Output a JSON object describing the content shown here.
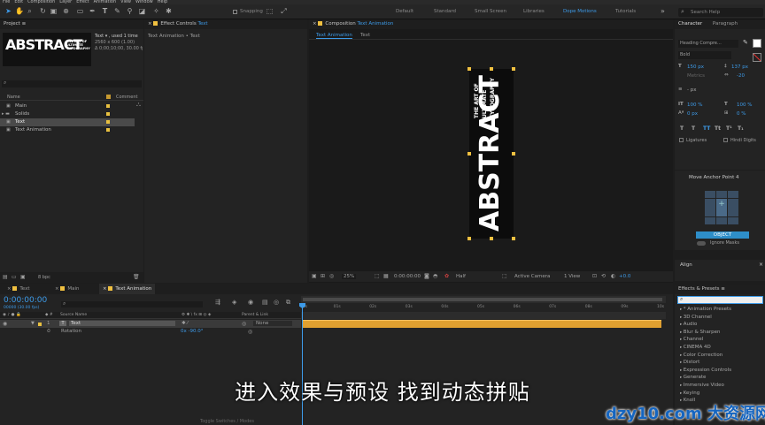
{
  "menu": [
    "File",
    "Edit",
    "Composition",
    "Layer",
    "Effect",
    "Animation",
    "View",
    "Window",
    "Help"
  ],
  "toolbar": {
    "snapping_label": "Snapping"
  },
  "workspaces": [
    {
      "label": "Default",
      "active": false
    },
    {
      "label": "Standard",
      "active": false
    },
    {
      "label": "Small Screen",
      "active": false
    },
    {
      "label": "Libraries",
      "active": false
    },
    {
      "label": "Dope Motions",
      "active": true
    },
    {
      "label": "Tutorials",
      "active": false
    }
  ],
  "help_search": {
    "placeholder": "Search Help"
  },
  "project": {
    "title": "Project",
    "thumb_title": "ABSTRACT",
    "thumb_subtitle": "THE ART OF ULTIMATE TYPOGRAPHY",
    "item_name": "Text ▾ , used 1 time",
    "item_size": "2560 x 600 (1.00)",
    "item_duration": "Δ 0;00;10;00, 30.00 fps",
    "col_name": "Name",
    "col_comment": "Comment",
    "items": [
      {
        "label": "Main",
        "type": "comp",
        "selected": false
      },
      {
        "label": "Solids",
        "type": "folder",
        "selected": false
      },
      {
        "label": "Text",
        "type": "comp",
        "selected": true
      },
      {
        "label": "Text Animation",
        "type": "comp",
        "selected": false
      }
    ],
    "bpc": "8 bpc"
  },
  "effect_controls": {
    "title": "Effect Controls",
    "layer": "Text",
    "breadcrumb": "Text Animation • Text"
  },
  "composition": {
    "title": "Composition",
    "name": "Text Animation",
    "tabs": [
      "Text Animation",
      "Text"
    ],
    "art_main": "ABSTRACT",
    "art_line1": "THE ART OF",
    "art_line2": "ULTIMATE",
    "art_line3": "TYPOGRAPHY",
    "zoom": "25%",
    "timecode": "0:00:00:00",
    "resolution": "Half",
    "camera": "Active Camera",
    "view": "1 View",
    "exposure": "+0.0"
  },
  "character": {
    "tab1": "Character",
    "tab2": "Paragraph",
    "font": "Heading Compre...",
    "style": "Bold",
    "size": "150 px",
    "leading": "Metrics",
    "tracking": "137 px",
    "kerning": "-20",
    "stroke": "- px",
    "vscale": "100 %",
    "hscale": "100 %",
    "baseline": "0 px",
    "tsume": "0 %",
    "styles": [
      "T",
      "T",
      "TT",
      "Tt",
      "T¹",
      "T₁"
    ],
    "ligatures": "Ligatures",
    "hindi": "Hindi Digits"
  },
  "anchor": {
    "title": "Move Anchor Point 4",
    "object_button": "OBJECT",
    "ignore_masks": "Ignore Masks"
  },
  "align": {
    "title": "Align"
  },
  "effects_presets": {
    "title": "Effects & Presets",
    "items": [
      "* Animation Presets",
      "3D Channel",
      "Audio",
      "Blur & Sharpen",
      "Channel",
      "CINEMA 4D",
      "Color Correction",
      "Distort",
      "Expression Controls",
      "Generate",
      "Immersive Video",
      "Keying",
      "Knoll"
    ]
  },
  "timeline": {
    "tabs": [
      {
        "label": "Text",
        "active": false
      },
      {
        "label": "Main",
        "active": false
      },
      {
        "label": "Text Animation",
        "active": true
      }
    ],
    "timecode": "0:00:00:00",
    "fps_info": "00000 (30.00 fps)",
    "col_source": "Source Name",
    "col_parent": "Parent & Link",
    "layer": {
      "index": "1",
      "name": "Text",
      "parent": "None"
    },
    "property": {
      "name": "Rotation",
      "value": "0x -90.0°"
    },
    "ruler": [
      "0s",
      "01s",
      "02s",
      "03s",
      "04s",
      "05s",
      "06s",
      "07s",
      "08s",
      "09s",
      "10s"
    ],
    "footer": "Toggle Switches / Modes"
  },
  "subtitle": "进入效果与预设 找到动态拼贴",
  "watermark": "dzy10.com 大资源网"
}
